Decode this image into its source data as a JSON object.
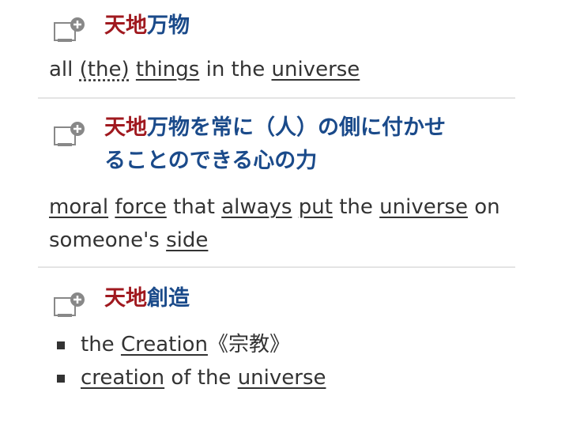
{
  "entries": [
    {
      "headword_highlight": "天地",
      "headword_rest": "万物",
      "definition": [
        {
          "t": "all ",
          "u": false
        },
        {
          "t": "(the)",
          "u": "opt"
        },
        {
          "t": " ",
          "u": false
        },
        {
          "t": "things",
          "u": true
        },
        {
          "t": " in the ",
          "u": false
        },
        {
          "t": "universe",
          "u": true
        }
      ]
    },
    {
      "headword_highlight": "天地",
      "headword_rest": "万物を常に（人）の側に付かせ",
      "headword_line2": "ることのできる心の力",
      "definition": [
        {
          "t": "moral",
          "u": true
        },
        {
          "t": " ",
          "u": false
        },
        {
          "t": "force",
          "u": true
        },
        {
          "t": " that ",
          "u": false
        },
        {
          "t": "always",
          "u": true
        },
        {
          "t": " ",
          "u": false
        },
        {
          "t": "put",
          "u": true
        },
        {
          "t": " the ",
          "u": false
        },
        {
          "t": "universe",
          "u": true
        },
        {
          "t": " on someone's ",
          "u": false
        },
        {
          "t": "side",
          "u": true
        }
      ]
    },
    {
      "headword_highlight": "天地",
      "headword_rest": "創造",
      "bullets": [
        [
          {
            "t": "the ",
            "u": false
          },
          {
            "t": "Creation",
            "u": true
          },
          {
            "t": "《宗教》",
            "u": false
          }
        ],
        [
          {
            "t": "creation",
            "u": true
          },
          {
            "t": " of the ",
            "u": false
          },
          {
            "t": "universe",
            "u": true
          }
        ]
      ]
    }
  ],
  "icons": {
    "add_to_wordbook": "add-to-wordbook-icon"
  },
  "colors": {
    "headword_highlight": "#a0191f",
    "headword": "#1a4a8a",
    "text": "#333333",
    "divider": "#e4e4e4"
  }
}
